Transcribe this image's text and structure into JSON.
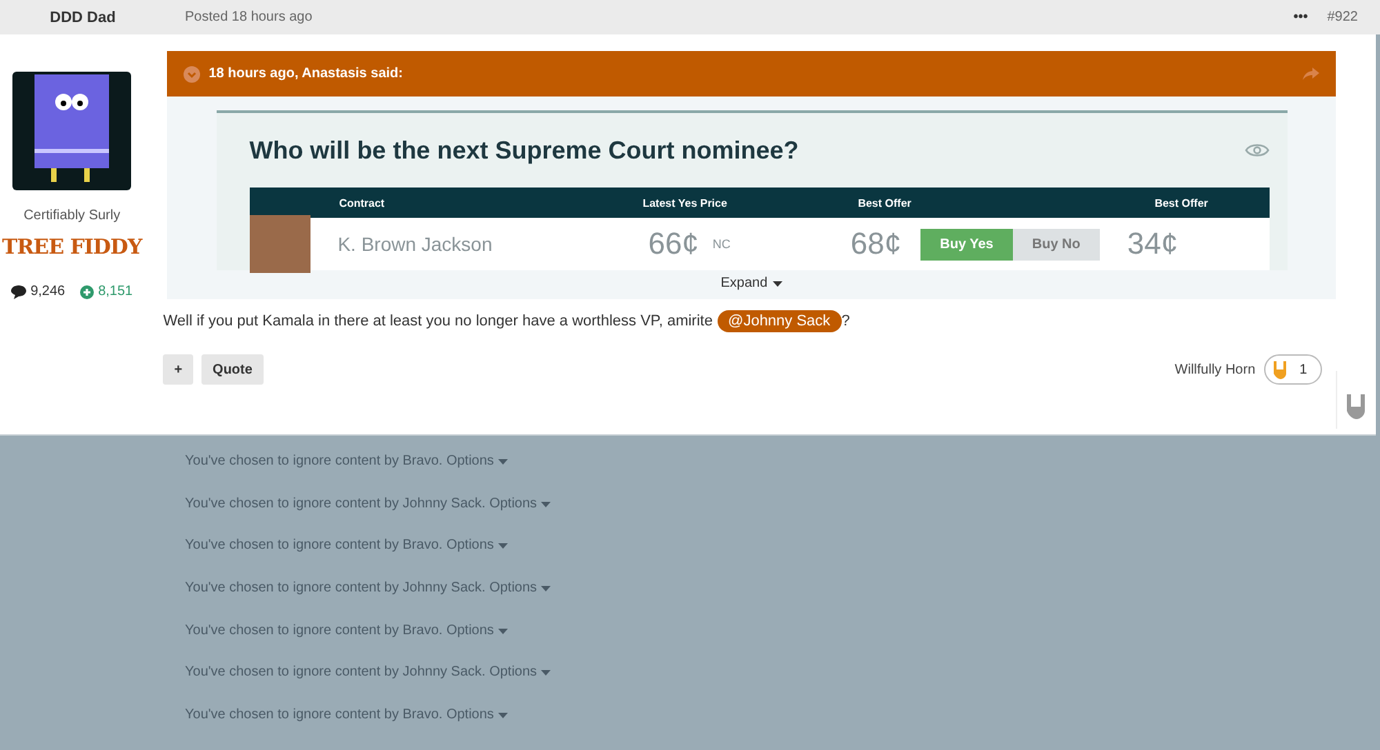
{
  "post_header": {
    "author": "DDD Dad",
    "posted": "Posted 18 hours ago",
    "menu": "•••",
    "number": "#922"
  },
  "profile": {
    "title": "Certifiably Surly",
    "rank": "TREE FIDDY",
    "posts": "9,246",
    "reputation": "8,151"
  },
  "quote": {
    "header": "18 hours ago, Anastasis said:",
    "embed": {
      "title": "Who will be the next Supreme Court nominee?",
      "columns": [
        "Contract",
        "Latest Yes Price",
        "Best Offer",
        "Best Offer"
      ],
      "row": {
        "name": "K. Brown Jackson",
        "price": "66¢",
        "change": "NC",
        "yes_offer": "68¢",
        "buy_yes": "Buy Yes",
        "buy_no": "Buy No",
        "no_offer": "34¢"
      }
    },
    "expand": "Expand"
  },
  "message": {
    "text": "Well if you put Kamala in there at least you no longer have a worthless VP, amirite",
    "mention": "@Johnny Sack",
    "after": "?"
  },
  "actions": {
    "add": "+",
    "quote": "Quote",
    "reaction_label": "Willfully Horn",
    "reaction_count": "1"
  },
  "ignored": [
    {
      "text": "You've chosen to ignore content by Bravo.",
      "options": "Options"
    },
    {
      "text": "You've chosen to ignore content by Johnny Sack.",
      "options": "Options"
    },
    {
      "text": "You've chosen to ignore content by Bravo.",
      "options": "Options"
    },
    {
      "text": "You've chosen to ignore content by Johnny Sack.",
      "options": "Options"
    },
    {
      "text": "You've chosen to ignore content by Bravo.",
      "options": "Options"
    },
    {
      "text": "You've chosen to ignore content by Johnny Sack.",
      "options": "Options"
    },
    {
      "text": "You've chosen to ignore content by Bravo.",
      "options": "Options"
    }
  ]
}
